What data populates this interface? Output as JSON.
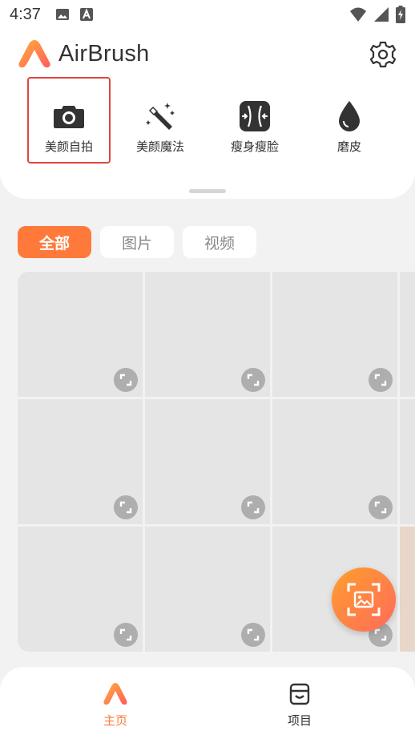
{
  "status_bar": {
    "time": "4:37",
    "icons": [
      "image-notification-icon",
      "a-notification-icon",
      "wifi-icon",
      "signal-icon",
      "battery-charging-icon"
    ]
  },
  "header": {
    "app_name": "AirBrush",
    "logo": "airbrush-logo-icon",
    "settings_icon": "gear-icon"
  },
  "tools": [
    {
      "label": "美颜自拍",
      "icon": "camera-icon",
      "selected": true
    },
    {
      "label": "美颜魔法",
      "icon": "magic-wand-icon",
      "selected": false
    },
    {
      "label": "瘦身瘦脸",
      "icon": "slim-body-icon",
      "selected": false
    },
    {
      "label": "磨皮",
      "icon": "drop-icon",
      "selected": false
    }
  ],
  "filters": [
    {
      "label": "全部",
      "active": true
    },
    {
      "label": "图片",
      "active": false
    },
    {
      "label": "视频",
      "active": false
    }
  ],
  "gallery": {
    "rows": 3,
    "columns": 3,
    "tile_icon": "expand-icon"
  },
  "fab": {
    "icon": "scan-image-icon"
  },
  "bottom_nav": [
    {
      "label": "主页",
      "icon": "home-logo-icon",
      "active": true
    },
    {
      "label": "项目",
      "icon": "inbox-icon",
      "active": false
    }
  ],
  "colors": {
    "accent": "#ff7a3a",
    "selected_border": "#e0443c",
    "tile": "#e5e5e5",
    "background": "#f2f2f2"
  }
}
